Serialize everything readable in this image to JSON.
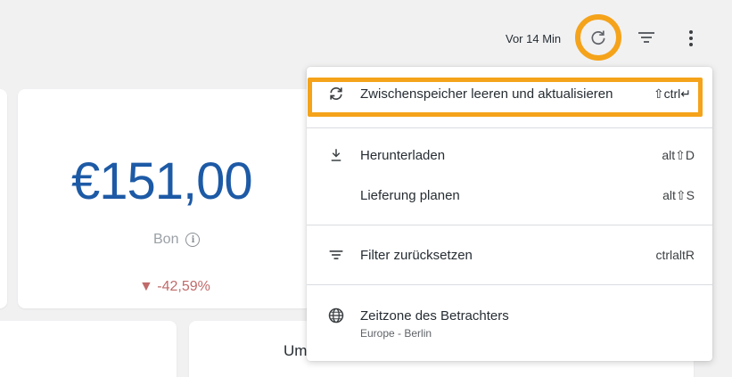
{
  "toolbar": {
    "updated_text": "Vor 14 Min",
    "refresh_icon": "refresh-icon",
    "filter_icon": "filter-icon",
    "more_icon": "more-vert-icon"
  },
  "kpi": {
    "value": "€151,00",
    "label": "Bon",
    "delta": "▼ -42,59%"
  },
  "bottom_card": {
    "title": "Um"
  },
  "menu": {
    "clear_cache": {
      "label": "Zwischenspeicher leeren und aktualisieren",
      "shortcut": "⇧ctrl↵",
      "icon": "sync-icon"
    },
    "download": {
      "label": "Herunterladen",
      "shortcut": "alt⇧D",
      "icon": "download-icon"
    },
    "schedule": {
      "label": "Lieferung planen",
      "shortcut": "alt⇧S"
    },
    "reset_filters": {
      "label": "Filter zurücksetzen",
      "shortcut": "ctrlaltR",
      "icon": "filter-list-icon"
    },
    "timezone": {
      "label": "Zeitzone des Betrachters",
      "value": "Europe - Berlin",
      "icon": "globe-icon"
    }
  },
  "colors": {
    "highlight": "#f5a31a",
    "kpi_value": "#1d5aa6",
    "kpi_delta": "#c06a6a"
  }
}
